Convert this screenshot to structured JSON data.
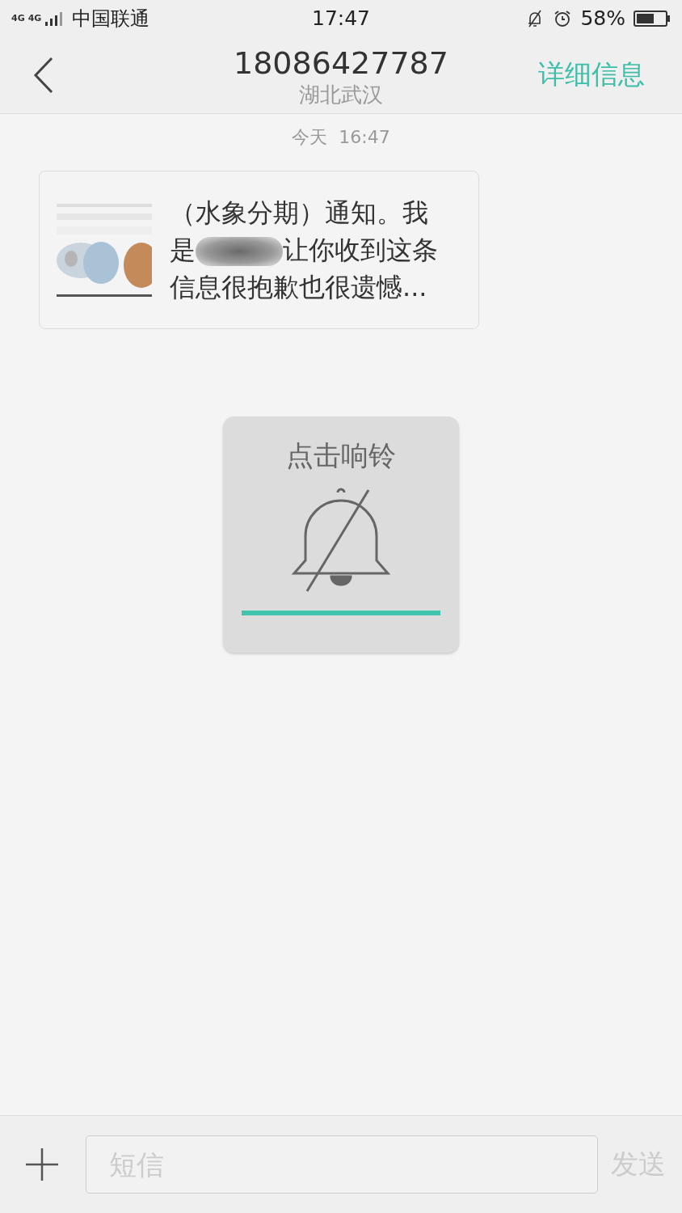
{
  "status_bar": {
    "network_labels": [
      "4G",
      "4G"
    ],
    "carrier": "中国联通",
    "time": "17:47",
    "battery": "58%"
  },
  "header": {
    "number": "18086427787",
    "location": "湖北武汉",
    "details_link": "详细信息"
  },
  "timestamp": "今天  16:47",
  "message": {
    "text_before": "（水象分期）通知。我是",
    "text_after": "让你收到这条信息很抱歉也很遗憾..."
  },
  "ring_card": {
    "title": "点击响铃"
  },
  "composer": {
    "placeholder": "短信",
    "send": "发送"
  }
}
